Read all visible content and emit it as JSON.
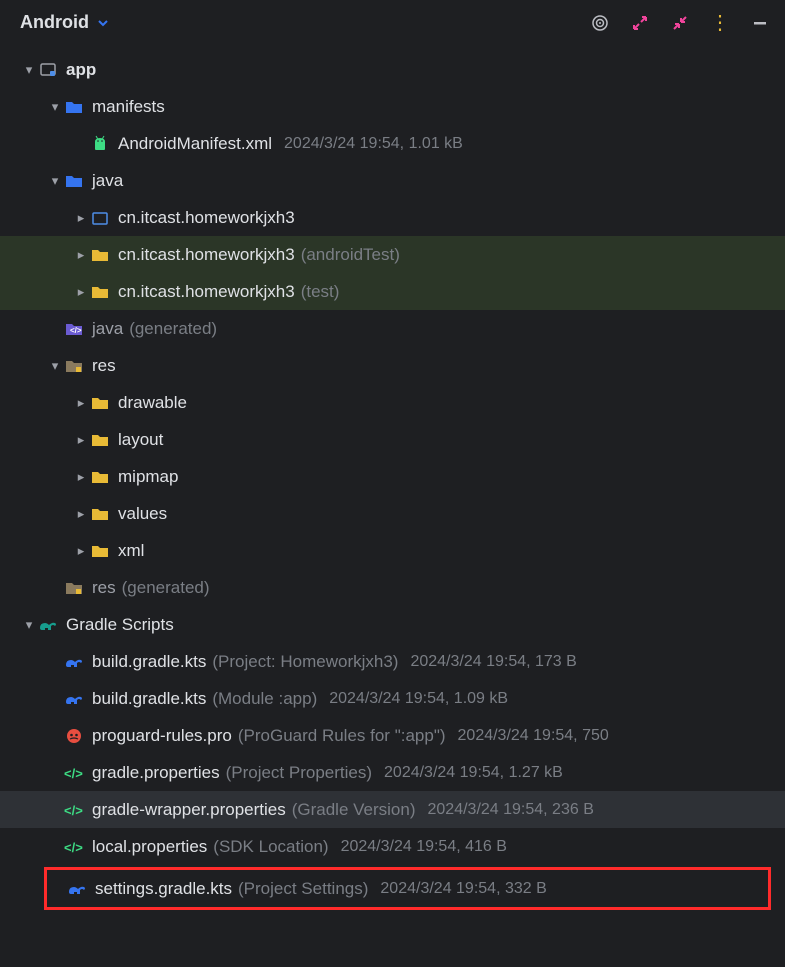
{
  "header": {
    "title": "Android"
  },
  "tree": {
    "app": {
      "label": "app",
      "manifests": {
        "label": "manifests",
        "androidManifest": {
          "name": "AndroidManifest.xml",
          "meta": "2024/3/24 19:54, 1.01 kB"
        }
      },
      "java": {
        "label": "java",
        "pkg1": {
          "name": "cn.itcast.homeworkjxh3"
        },
        "pkg2": {
          "name": "cn.itcast.homeworkjxh3",
          "sub": "(androidTest)"
        },
        "pkg3": {
          "name": "cn.itcast.homeworkjxh3",
          "sub": "(test)"
        }
      },
      "javaGen": {
        "name": "java",
        "sub": "(generated)"
      },
      "res": {
        "label": "res",
        "drawable": "drawable",
        "layout": "layout",
        "mipmap": "mipmap",
        "values": "values",
        "xml": "xml"
      },
      "resGen": {
        "name": "res",
        "sub": "(generated)"
      }
    },
    "gradle": {
      "label": "Gradle Scripts",
      "build1": {
        "name": "build.gradle.kts",
        "sub": "(Project: Homeworkjxh3)",
        "meta": "2024/3/24 19:54, 173 B"
      },
      "build2": {
        "name": "build.gradle.kts",
        "sub": "(Module :app)",
        "meta": "2024/3/24 19:54, 1.09 kB"
      },
      "proguard": {
        "name": "proguard-rules.pro",
        "sub": "(ProGuard Rules for \":app\")",
        "meta": "2024/3/24 19:54, 750"
      },
      "gradleProps": {
        "name": "gradle.properties",
        "sub": "(Project Properties)",
        "meta": "2024/3/24 19:54, 1.27 kB"
      },
      "wrapper": {
        "name": "gradle-wrapper.properties",
        "sub": "(Gradle Version)",
        "meta": "2024/3/24 19:54, 236 B"
      },
      "local": {
        "name": "local.properties",
        "sub": "(SDK Location)",
        "meta": "2024/3/24 19:54, 416 B"
      },
      "settings": {
        "name": "settings.gradle.kts",
        "sub": "(Project Settings)",
        "meta": "2024/3/24 19:54, 332 B"
      }
    }
  }
}
